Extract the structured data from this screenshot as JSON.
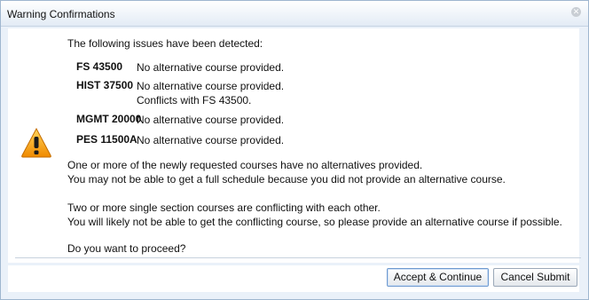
{
  "dialog": {
    "title": "Warning Confirmations",
    "close_icon": "close-icon",
    "warning_icon": "warning-icon",
    "intro": "The following issues have been detected:",
    "issues": [
      {
        "code": "FS 43500",
        "lines": [
          "No alternative course provided."
        ]
      },
      {
        "code": "HIST 37500",
        "lines": [
          "No alternative course provided.",
          "Conflicts with FS 43500."
        ]
      },
      {
        "code": "MGMT 20000",
        "lines": [
          "No alternative course provided."
        ]
      },
      {
        "code": "PES 11500A",
        "lines": [
          "No alternative course provided."
        ]
      }
    ],
    "paragraphs": {
      "no_alt_1": "One or more of the newly requested courses have no alternatives provided.",
      "no_alt_2": "You may not be able to get a full schedule because you did not provide an alternative course.",
      "conflict_1": "Two or more single section courses are conflicting with each other.",
      "conflict_2": "You will likely not be able to get the conflicting course, so please provide an alternative course if possible.",
      "question": "Do you want to proceed?"
    },
    "buttons": {
      "accept": "Accept & Continue",
      "cancel": "Cancel Submit"
    },
    "colors": {
      "warning": "#f2a81d",
      "accent_border": "#6f9ad0",
      "dialog_bg": "#eaf1f9"
    }
  }
}
